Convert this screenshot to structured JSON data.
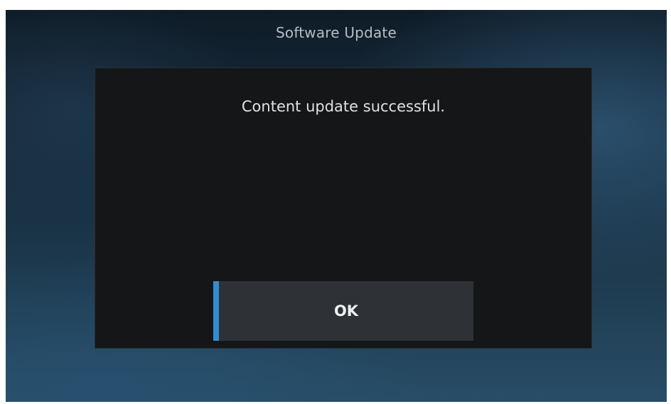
{
  "screen": {
    "title": "Software Update"
  },
  "dialog": {
    "message": "Content update successful.",
    "ok_label": "OK"
  },
  "colors": {
    "dialog_background": "#141618",
    "button_background": "#2e3236",
    "button_accent": "#2e8fd0",
    "title_text": "#b9bdc1",
    "message_text": "#dfe1e3"
  }
}
